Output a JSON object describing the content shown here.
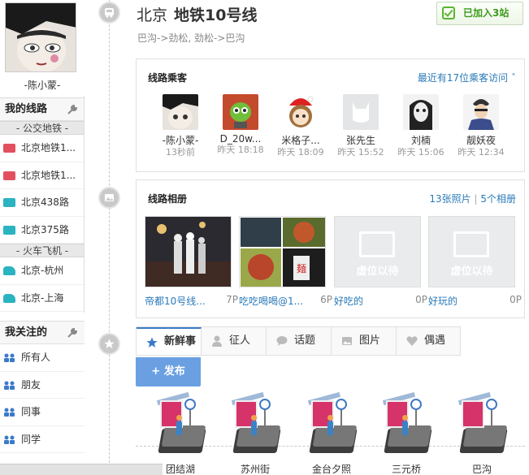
{
  "user": {
    "name": "-陈小蒙-"
  },
  "sidebar": {
    "my_lines_title": "我的线路",
    "groups": [
      {
        "label": "- 公交地铁 -",
        "items": [
          {
            "label": "北京地铁1...",
            "icon": "subway-icon"
          },
          {
            "label": "北京地铁1...",
            "icon": "subway-icon"
          },
          {
            "label": "北京438路",
            "icon": "bus-icon"
          },
          {
            "label": "北京375路",
            "icon": "bus-icon"
          }
        ]
      },
      {
        "label": "- 火车飞机 -",
        "items": [
          {
            "label": "北京-杭州",
            "icon": "train-icon"
          },
          {
            "label": "北京-上海",
            "icon": "train-icon"
          }
        ]
      }
    ],
    "following_title": "我关注的",
    "following_items": [
      {
        "label": "所有人"
      },
      {
        "label": "朋友"
      },
      {
        "label": "同事"
      },
      {
        "label": "同学"
      }
    ]
  },
  "header": {
    "city": "北京",
    "line_name": "地铁10号线",
    "route": "巴沟->劲松, 劲松->巴沟",
    "joined_label": "已加入3站"
  },
  "passengers": {
    "title": "线路乘客",
    "meta": "最近有17位乘客访问",
    "items": [
      {
        "name": "-陈小蒙-",
        "time": "13秒前"
      },
      {
        "name": "D_20w...",
        "time": "昨天 18:18"
      },
      {
        "name": "米格子...",
        "time": "昨天 18:09"
      },
      {
        "name": "张先生",
        "time": "昨天 15:52"
      },
      {
        "name": "刘楠",
        "time": "昨天 15:06"
      },
      {
        "name": "靓妖夜",
        "time": "昨天 12:34"
      }
    ]
  },
  "album": {
    "title": "线路相册",
    "photos_link": "13张照片",
    "albums_link": "5个相册",
    "separator": "|",
    "items": [
      {
        "caption": "帝都10号线...",
        "count": "7P",
        "placeholder": false,
        "placeholder_text": ""
      },
      {
        "caption": "吃吃喝喝@1...",
        "count": "6P",
        "placeholder": false,
        "placeholder_text": ""
      },
      {
        "caption": "好吃的",
        "count": "0P",
        "placeholder": true,
        "placeholder_text": "虚位以待"
      },
      {
        "caption": "好玩的",
        "count": "0P",
        "placeholder": true,
        "placeholder_text": "虚位以待"
      }
    ]
  },
  "tabs": [
    {
      "label": "新鲜事",
      "icon": "star-icon",
      "active": true
    },
    {
      "label": "征人",
      "icon": "person-icon",
      "active": false
    },
    {
      "label": "话题",
      "icon": "speech-bubble-icon",
      "active": false
    },
    {
      "label": "图片",
      "icon": "image-icon",
      "active": false
    },
    {
      "label": "偶遇",
      "icon": "heart-icon",
      "active": false
    }
  ],
  "publish_label": "+ 发布",
  "stations": [
    {
      "name": "团结湖"
    },
    {
      "name": "苏州街"
    },
    {
      "name": "金台夕照"
    },
    {
      "name": "三元桥"
    },
    {
      "name": "巴沟"
    }
  ],
  "colors": {
    "accent_blue": "#2a7ab8",
    "publish_button": "#6aa0e2",
    "joined_green": "#3d9a1e",
    "subway_icon": "#e25060",
    "bus_icon": "#2ab3c0"
  }
}
